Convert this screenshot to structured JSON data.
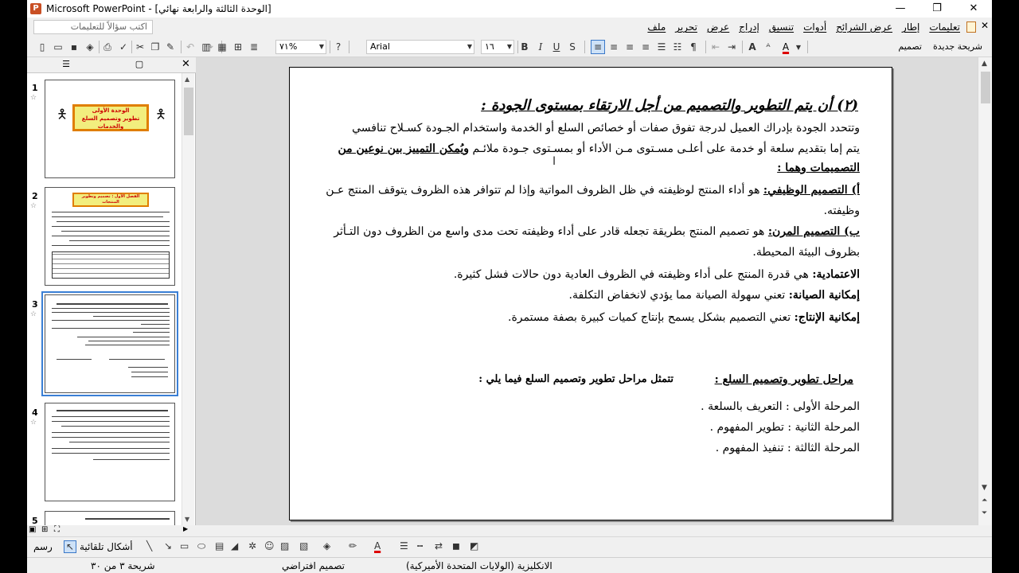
{
  "window": {
    "title": "Microsoft PowerPoint - [الوحدة الثالثة والرابعة نهائي]",
    "minimize": "—",
    "restore": "❐",
    "close": "✕"
  },
  "menubar": {
    "ask_placeholder": "اكتب سؤالاً للتعليمات",
    "menus": [
      "ملف",
      "تحرير",
      "عرض",
      "إدراج",
      "تنسيق",
      "أدوات",
      "عرض الشرائح",
      "إطار",
      "تعليمات"
    ],
    "doc_close": "✕"
  },
  "toolbar": {
    "zoom": "٧١%",
    "font": "Arial",
    "font_size": "١٦",
    "bold": "B",
    "italic": "I",
    "underline": "U",
    "shadow": "S",
    "grow_font": "A",
    "font_color": "A",
    "design_label": "تصميم",
    "new_slide_label": "شريحة جديدة"
  },
  "left_pane": {
    "slides": [
      {
        "number": "1",
        "title_lines": [
          "الوحدة الأولى",
          "تطوير وتصميم السلع",
          "والخدمات"
        ]
      },
      {
        "number": "2",
        "title_lines": [
          "الفصل الأول : تصميم وتطوير",
          "المنتجات"
        ]
      },
      {
        "number": "3"
      },
      {
        "number": "4"
      },
      {
        "number": "5"
      }
    ]
  },
  "slide": {
    "heading": "(٢) أن يتم التطوير والتصميم من أجل الارتقاء بمستوى الجودة :",
    "p1_line1": "وتتحدد الجودة بإدراك العميل لدرجة تفوق صفات أو خصائص السلع أو الخدمة واستخدام الجـودة كسـلاح تنافسي",
    "p1_line2_a": "يتم إما بتقديم سلعة أو خدمة على أعلـى مسـتوى مـن الأداء أو بمسـتوى جـودة ملائـم ",
    "p1_line2_b": "ويُمكن التمييز بين نوعين من",
    "p1_line3": "التصميمات وهما :",
    "a_label": "أ) التصميم الوظيفي:",
    "a_text": " هو أداء المنتج لوظيفته في ظل الظروف المواتية وإذا لم تتوافر هذه الظروف يتوقف المنتج عـن",
    "a_line2": "وظيفته.",
    "b_label": "ب) التصميم المرن:",
    "b_text": " هو تصميم المنتج بطريقة تجعله قادر على أداء وظيفته تحت مدى واسع من الظروف دون التـأثر",
    "b_line2": "بظروف البيئة المحيطة.",
    "rel_label": "الاعتمادية:",
    "rel_text": "  هي قدرة المنتج على أداء وظيفته في الظروف العادية دون حالات فشل كثيرة.",
    "maint_label": "إمكانية الصيانة:",
    "maint_text": " تعني سهولة الصيانة مما يؤدي لانخفاض التكلفة.",
    "prod_label": "إمكانية الإنتاج:",
    "prod_text": "  تعني التصميم بشكل يسمح بإنتاج كميات كبيرة بصفة مستمرة.",
    "stages_heading": "مراحل تطوير وتصميم السلع :",
    "stages_intro": "تتمثل مراحل تطوير وتصميم السلع فيما يلي :",
    "stage1": "المرحلة الأولى : التعريف بالسلعة .",
    "stage2": "المرحلة الثانية : تطوير المفهوم .",
    "stage3": "المرحلة الثالثة : تنفيذ المفهوم ."
  },
  "drawing_toolbar": {
    "draw": "رسم",
    "autoshapes": "أشكال تلقائية"
  },
  "status": {
    "slide_indicator": "شريحة ٣ من ٣٠",
    "design": "تصميم افتراضي",
    "language": "الانكليزية (الولايات المتحدة الأميركية)"
  }
}
